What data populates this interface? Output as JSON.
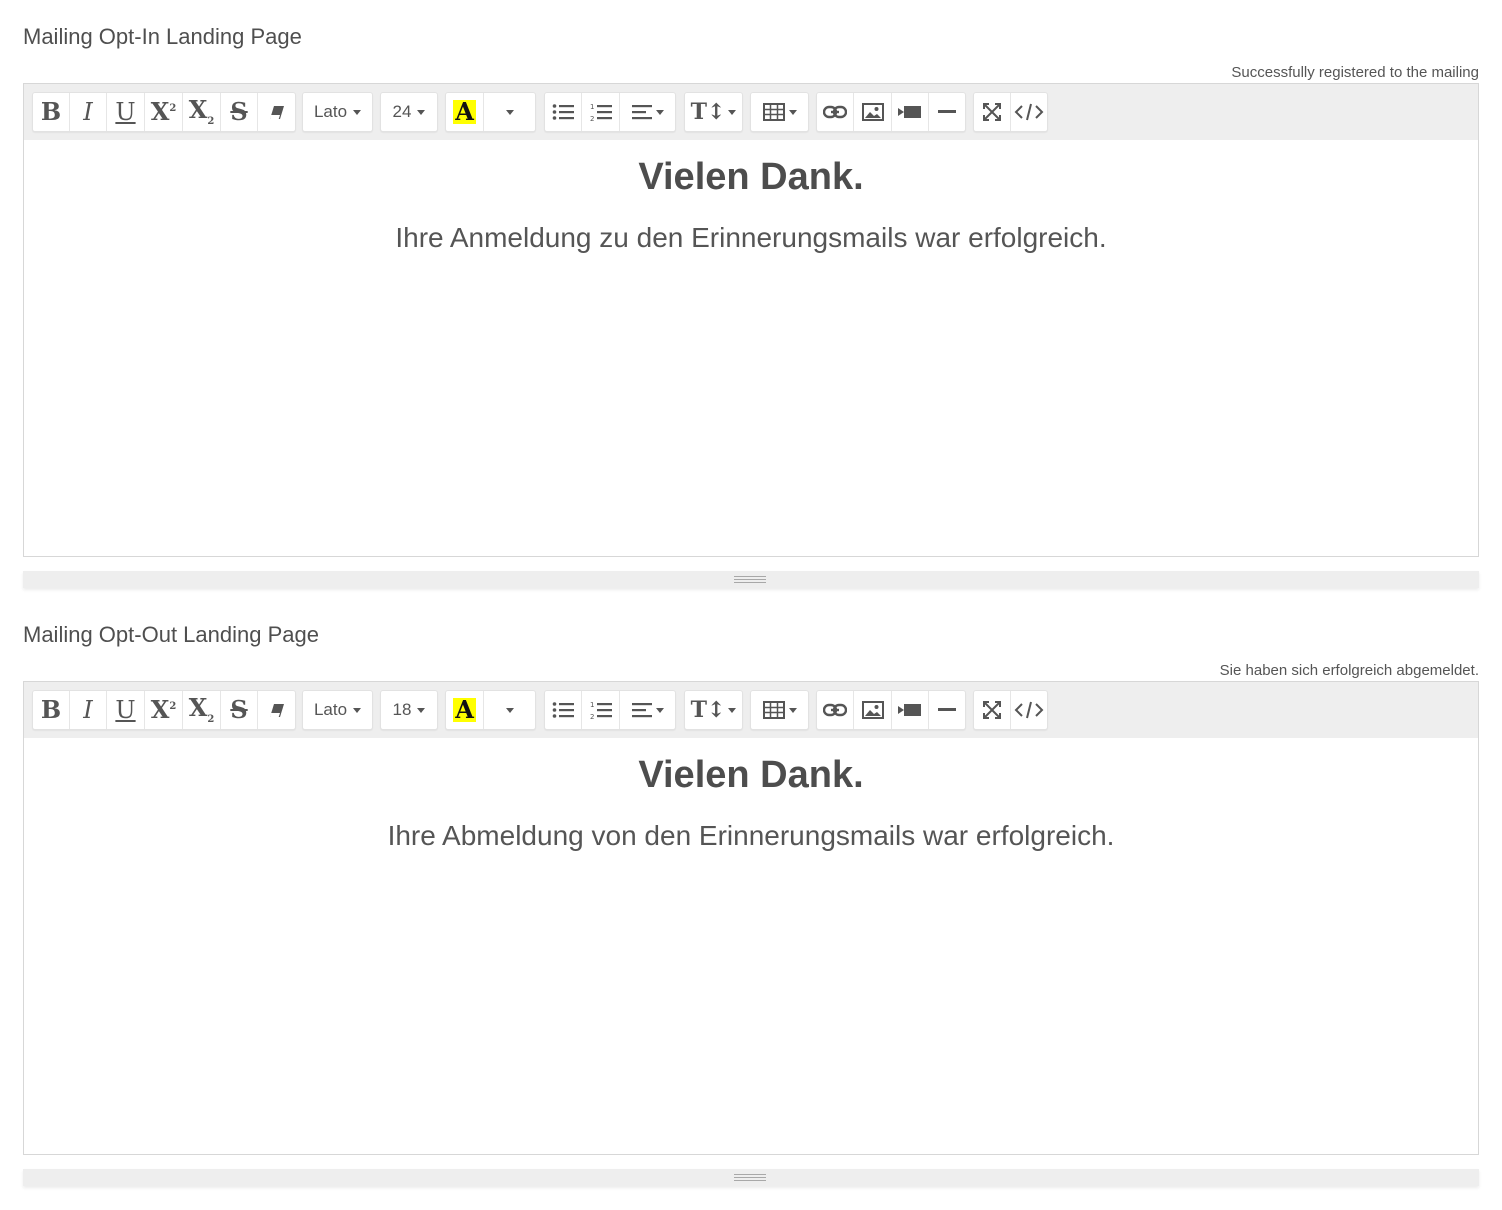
{
  "sections": [
    {
      "label": "Mailing Opt-In Landing Page",
      "hint": "Successfully registered to the mailing",
      "toolbar": {
        "font": "Lato",
        "size": "24",
        "highlight": "#ffff00"
      },
      "content": {
        "heading": "Vielen Dank.",
        "text": "Ihre Anmeldung zu den Erinnerungsmails war erfolgreich."
      }
    },
    {
      "label": "Mailing Opt-Out Landing Page",
      "hint": "Sie haben sich erfolgreich abgemeldet.",
      "toolbar": {
        "font": "Lato",
        "size": "18",
        "highlight": "#ffff00"
      },
      "content": {
        "heading": "Vielen Dank.",
        "text": "Ihre Abmeldung von den Erinnerungsmails war erfolgreich."
      }
    }
  ],
  "toolbar_icons": [
    "bold-icon",
    "italic-icon",
    "underline-icon",
    "superscript-icon",
    "subscript-icon",
    "strikethrough-icon",
    "eraser-icon",
    "font-family-dropdown",
    "font-size-dropdown",
    "text-color-icon",
    "color-dropdown",
    "unordered-list-icon",
    "ordered-list-icon",
    "align-icon",
    "line-height-icon",
    "table-icon",
    "link-icon",
    "picture-icon",
    "video-icon",
    "horizontal-rule-icon",
    "fullscreen-icon",
    "code-view-icon"
  ]
}
